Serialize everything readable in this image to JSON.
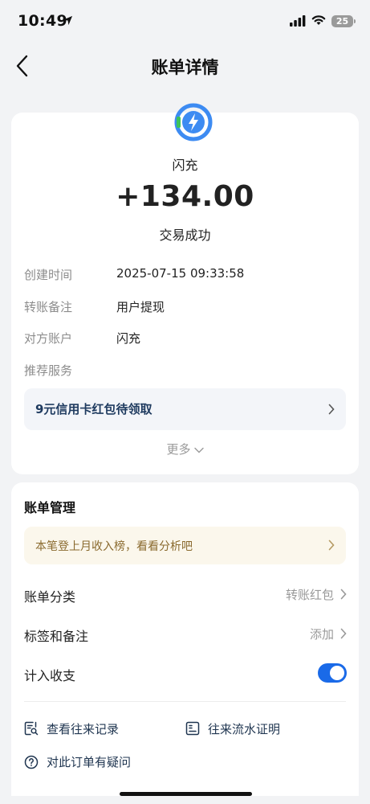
{
  "status_bar": {
    "time": "10:49",
    "battery": "25"
  },
  "nav": {
    "title": "账单详情"
  },
  "transaction": {
    "merchant": "闪充",
    "amount": "+134.00",
    "status": "交易成功",
    "details": [
      {
        "label": "创建时间",
        "value": "2025-07-15 09:33:58"
      },
      {
        "label": "转账备注",
        "value": "用户提现"
      },
      {
        "label": "对方账户",
        "value": "闪充"
      },
      {
        "label": "推荐服务",
        "value": ""
      }
    ],
    "promo": "9元信用卡红包待领取",
    "more": "更多"
  },
  "management": {
    "title": "账单管理",
    "analysis_tip": "本笔登上月收入榜，看看分析吧",
    "category": {
      "label": "账单分类",
      "value": "转账红包"
    },
    "tags": {
      "label": "标签和备注",
      "value": "添加"
    },
    "include": {
      "label": "计入收支",
      "enabled": true
    },
    "links": {
      "history": "查看往来记录",
      "proof": "往来流水证明",
      "question": "对此订单有疑问"
    }
  },
  "colors": {
    "accent": "#1a6ae8",
    "logo_blue": "#3d8bf2",
    "logo_green": "#3cc35a"
  }
}
